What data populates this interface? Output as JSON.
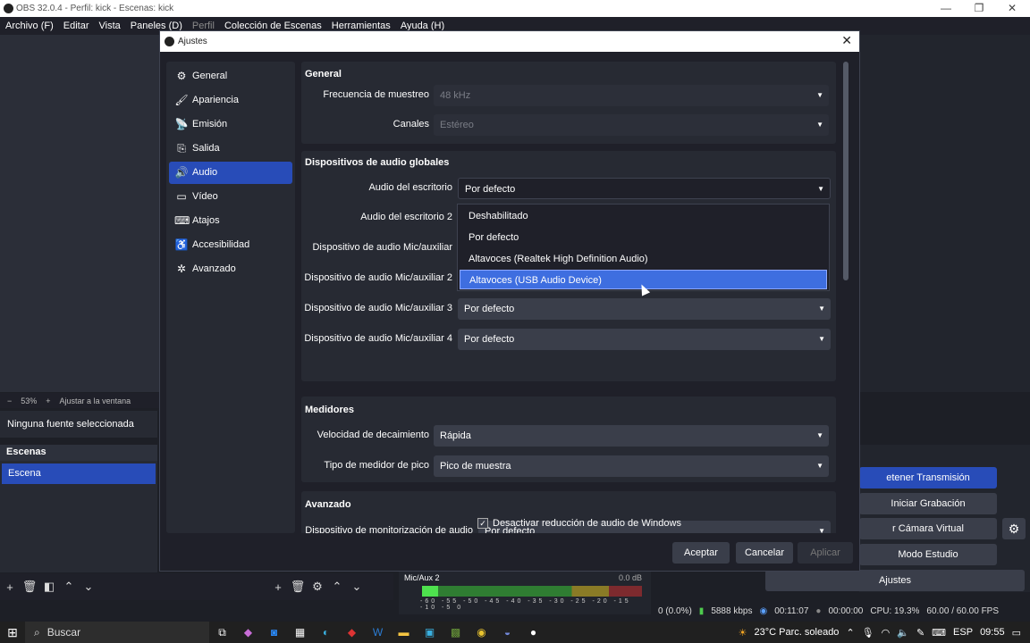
{
  "window": {
    "title": "OBS 32.0.4 - Perfil: kick - Escenas: kick",
    "minimize": "—",
    "maximize": "❐",
    "close": "✕"
  },
  "menubar": [
    "Archivo (F)",
    "Editar",
    "Vista",
    "Paneles (D)",
    "Perfil",
    "Colección de Escenas",
    "Herramientas",
    "Ayuda (H)"
  ],
  "main": {
    "zoom": "53%",
    "zoom_minus": "−",
    "zoom_plus": "+",
    "fit": "Ajustar a la ventana",
    "no_source": "Ninguna fuente seleccionada",
    "scenes_header": "Escenas",
    "scene_item": "Escena",
    "mixer_label": "Mic/Aux 2",
    "mixer_db": "0.0 dB",
    "mixer_scale": "-60 -55 -50 -45 -40 -35 -30 -25 -20 -15 -10 -5 0",
    "controls": {
      "stop_stream": "etener Transmisión",
      "start_rec": "Iniciar Grabación",
      "virtual_cam": "r Cámara Virtual",
      "studio_mode": "Modo Estudio",
      "settings": "Ajustes"
    },
    "status": {
      "dropped": "0 (0.0%)",
      "kbps": "5888 kbps",
      "stream_time": "00:11:07",
      "rec_time": "00:00:00",
      "cpu": "CPU: 19.3%",
      "fps": "60.00 / 60.00 FPS"
    }
  },
  "dialog": {
    "title": "Ajustes",
    "nav": [
      {
        "icon": "⚙",
        "label": "General"
      },
      {
        "icon": "🖌",
        "label": "Apariencia"
      },
      {
        "icon": "📡",
        "label": "Emisión"
      },
      {
        "icon": "⎘",
        "label": "Salida"
      },
      {
        "icon": "🔊",
        "label": "Audio"
      },
      {
        "icon": "▭",
        "label": "Vídeo"
      },
      {
        "icon": "⌨",
        "label": "Atajos"
      },
      {
        "icon": "♿",
        "label": "Accesibilidad"
      },
      {
        "icon": "✲",
        "label": "Avanzado"
      }
    ],
    "general": {
      "title": "General",
      "sample_rate_label": "Frecuencia de muestreo",
      "sample_rate_value": "48 kHz",
      "channels_label": "Canales",
      "channels_value": "Estéreo"
    },
    "global_devices": {
      "title": "Dispositivos de audio globales",
      "desktop_label": "Audio del escritorio",
      "desktop_value": "Por defecto",
      "desktop2_label": "Audio del escritorio 2",
      "mic_label": "Dispositivo de audio Mic/auxiliar",
      "mic2_label": "Dispositivo de audio Mic/auxiliar 2",
      "mic3_label": "Dispositivo de audio Mic/auxiliar 3",
      "mic3_value": "Por defecto",
      "mic4_label": "Dispositivo de audio Mic/auxiliar 4",
      "mic4_value": "Por defecto"
    },
    "dropdown_options": [
      "Deshabilitado",
      "Por defecto",
      "Altavoces (Realtek High Definition Audio)",
      "Altavoces (USB Audio Device)"
    ],
    "meters": {
      "title": "Medidores",
      "decay_label": "Velocidad de decaimiento",
      "decay_value": "Rápida",
      "peak_label": "Tipo de medidor de pico",
      "peak_value": "Pico de muestra"
    },
    "advanced": {
      "title": "Avanzado",
      "monitor_label": "Dispositivo de monitorización de audio",
      "monitor_value": "Por defecto",
      "ducking_label": "Desactivar reducción de audio de Windows",
      "ducking_checked": "✓"
    },
    "buttons": {
      "ok": "Aceptar",
      "cancel": "Cancelar",
      "apply": "Aplicar"
    }
  },
  "taskbar": {
    "search": "Buscar",
    "weather": "23°C Parc. soleado",
    "lang": "ESP",
    "time": "09:55"
  }
}
